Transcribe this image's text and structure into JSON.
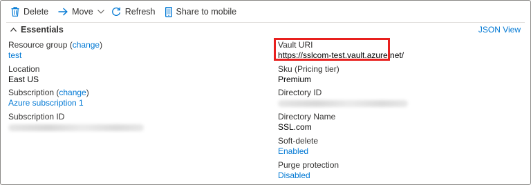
{
  "toolbar": {
    "delete_label": "Delete",
    "move_label": "Move",
    "refresh_label": "Refresh",
    "share_label": "Share to mobile"
  },
  "essentials": {
    "title": "Essentials",
    "json_view": "JSON View"
  },
  "left": {
    "resource_group_label": "Resource group (",
    "resource_group_change": "change",
    "resource_group_close": ")",
    "resource_group_value": "test",
    "location_label": "Location",
    "location_value": "East US",
    "subscription_label": "Subscription (",
    "subscription_change": "change",
    "subscription_close": ")",
    "subscription_value": "Azure subscription 1",
    "subscription_id_label": "Subscription ID"
  },
  "right": {
    "vault_uri_label": "Vault URI",
    "vault_uri_value": "https://sslcom-test.vault.azure.net/",
    "sku_label": "Sku (Pricing tier)",
    "sku_value": "Premium",
    "directory_id_label": "Directory ID",
    "directory_name_label": "Directory Name",
    "directory_name_value": "SSL.com",
    "soft_delete_label": "Soft-delete",
    "soft_delete_value": "Enabled",
    "purge_label": "Purge protection",
    "purge_value": "Disabled"
  },
  "colors": {
    "accent": "#0078d4",
    "highlight": "#e8201e"
  },
  "icons": {
    "delete": "trash-icon",
    "move": "arrow-right-icon",
    "refresh": "refresh-icon",
    "share": "mobile-icon",
    "collapse": "chevron-up-icon"
  }
}
